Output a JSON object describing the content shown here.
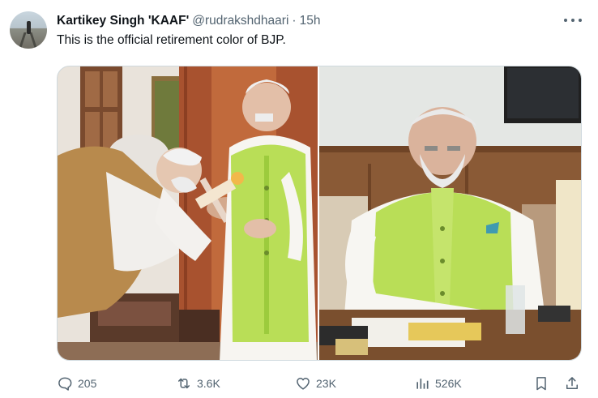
{
  "tweet": {
    "author_name": "Kartikey Singh 'KAAF'",
    "handle": "@rudrakshdhaari",
    "separator": "·",
    "time": "15h",
    "text": "This is the official retirement color of BJP."
  },
  "actions": {
    "replies": "205",
    "reposts": "3.6K",
    "likes": "23K",
    "views": "526K"
  },
  "colors": {
    "text_primary": "#0f1419",
    "text_secondary": "#536471",
    "border": "#cfd9de",
    "vest_green": "#b9de57"
  },
  "icons": {
    "reply": "reply-icon",
    "repost": "repost-icon",
    "like": "heart-icon",
    "views": "views-icon",
    "bookmark": "bookmark-icon",
    "share": "share-icon",
    "more": "more-icon"
  }
}
